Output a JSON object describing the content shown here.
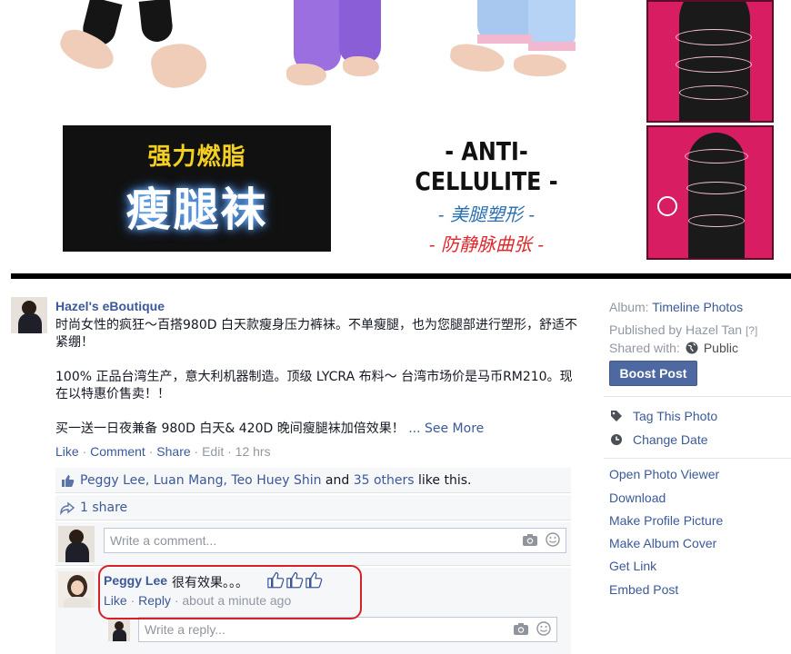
{
  "banner": {
    "black_panel_line1": "强力燃脂",
    "black_panel_line2": "瘦腿袜",
    "text_panel_line1": "- ANTI-CELLULITE -",
    "text_panel_line2": "- 美腿塑形 -",
    "text_panel_line3": "- 防静脉曲张 -"
  },
  "post": {
    "author": "Hazel's eBoutique",
    "paragraphs": [
      "时尚女性的疯狂～百搭980D 白天款瘦身压力裤袜。不单瘦腿，也为您腿部进行塑形，舒适不紧绷！",
      "100% 正品台湾生产，意大利机器制造。顶级 LYCRA 布料～ 台湾市场价是马币RM210。现在以特惠价售卖！！"
    ],
    "last_line": "买一送一日夜兼备 980D 白天& 420D 晚间瘦腿袜加倍效果！",
    "see_more": "... See More",
    "actions": {
      "like": "Like",
      "comment": "Comment",
      "share": "Share",
      "edit": "Edit",
      "time": "12 hrs",
      "sep": " · "
    }
  },
  "ufi": {
    "likers": "Peggy Lee, Luan Mang, Teo Huey Shin",
    "and": "and",
    "others": "35 others",
    "like_this": "like this.",
    "shares": "1 share",
    "comment_placeholder": "Write a comment...",
    "comment": {
      "author": "Peggy Lee",
      "text": "很有效果。。。",
      "like": "Like",
      "reply": "Reply",
      "time": "about a minute ago",
      "sep": " · "
    },
    "reply_placeholder": "Write a reply..."
  },
  "sidebar": {
    "album_label": "Album:",
    "album_name": "Timeline Photos",
    "published_by": "Published by Hazel Tan",
    "published_help": "[?]",
    "shared_with_label": "Shared with:",
    "shared_with_value": "Public",
    "boost_button": "Boost Post",
    "tag_photo": "Tag This Photo",
    "change_date": "Change Date",
    "links": [
      "Open Photo Viewer",
      "Download",
      "Make Profile Picture",
      "Make Album Cover",
      "Get Link",
      "Embed Post"
    ]
  },
  "colors": {
    "link": "#3b5998",
    "muted": "#9197a3",
    "boost": "#4e69a2",
    "highlight_ring": "#d62027",
    "pink_panel": "#d81d62"
  },
  "icons": [
    "thumbs-up-icon",
    "share-arrow-icon",
    "camera-icon",
    "smiley-icon",
    "globe-icon",
    "tag-icon",
    "clock-icon"
  ]
}
